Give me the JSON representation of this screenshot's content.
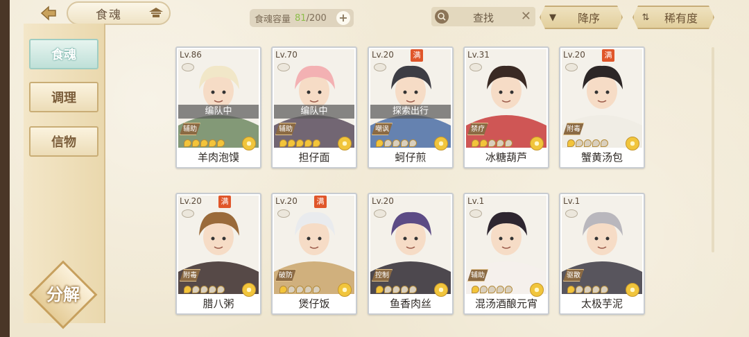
{
  "header": {
    "title": "食魂",
    "back_icon": "back-arrow-icon",
    "capacity_label": "食魂容量",
    "capacity_current": "81",
    "capacity_max": "/200",
    "plus_label": "+",
    "search_placeholder": "查找",
    "sort_order_label": "降序",
    "sort_key_label": "稀有度"
  },
  "sidebar": {
    "items": [
      {
        "label": "食魂",
        "active": true
      },
      {
        "label": "调理",
        "active": false
      },
      {
        "label": "信物",
        "active": false
      }
    ],
    "decompose_label": "分解"
  },
  "cards": [
    {
      "level": "Lv.86",
      "max": false,
      "status": "编队中",
      "role": "辅助",
      "stars": 5,
      "name": "羊肉泡馍",
      "hair": "#f1e7c8",
      "outfit": "#6e8a63"
    },
    {
      "level": "Lv.70",
      "max": false,
      "status": "编队中",
      "role": "辅助",
      "stars": 5,
      "name": "担仔面",
      "hair": "#f3b1b3",
      "outfit": "#5a4d5e"
    },
    {
      "level": "Lv.20",
      "max": true,
      "status": "探索出行",
      "role": "嘲讽",
      "stars": 1,
      "name": "蚵仔煎",
      "hair": "#3d3d44",
      "outfit": "#4b6ea6"
    },
    {
      "level": "Lv.31",
      "max": false,
      "status": "",
      "role": "禁疗",
      "stars": 2,
      "name": "冰糖葫芦",
      "hair": "#3a2a24",
      "outfit": "#c83b3b"
    },
    {
      "level": "Lv.20",
      "max": true,
      "status": "",
      "role": "附毒",
      "stars": 1,
      "name": "蟹黄汤包",
      "hair": "#2c2626",
      "outfit": "#efece4"
    },
    {
      "level": "Lv.20",
      "max": true,
      "status": "",
      "role": "附毒",
      "stars": 1,
      "name": "腊八粥",
      "hair": "#9a6a3a",
      "outfit": "#3a2c2a"
    },
    {
      "level": "Lv.20",
      "max": true,
      "status": "",
      "role": "破防",
      "stars": 1,
      "name": "煲仔饭",
      "hair": "#e9ebee",
      "outfit": "#c9a56a"
    },
    {
      "level": "Lv.20",
      "max": false,
      "status": "",
      "role": "控制",
      "stars": 1,
      "name": "鱼香肉丝",
      "hair": "#5c4b85",
      "outfit": "#2f2a33"
    },
    {
      "level": "Lv.1",
      "max": false,
      "status": "",
      "role": "辅助",
      "stars": 1,
      "name": "混汤酒酿元宵",
      "hair": "#2e2630",
      "outfit": "#f4f0ec"
    },
    {
      "level": "Lv.1",
      "max": false,
      "status": "",
      "role": "驱散",
      "stars": 1,
      "name": "太极芋泥",
      "hair": "#b9b7bd",
      "outfit": "#3c3a44"
    }
  ]
}
